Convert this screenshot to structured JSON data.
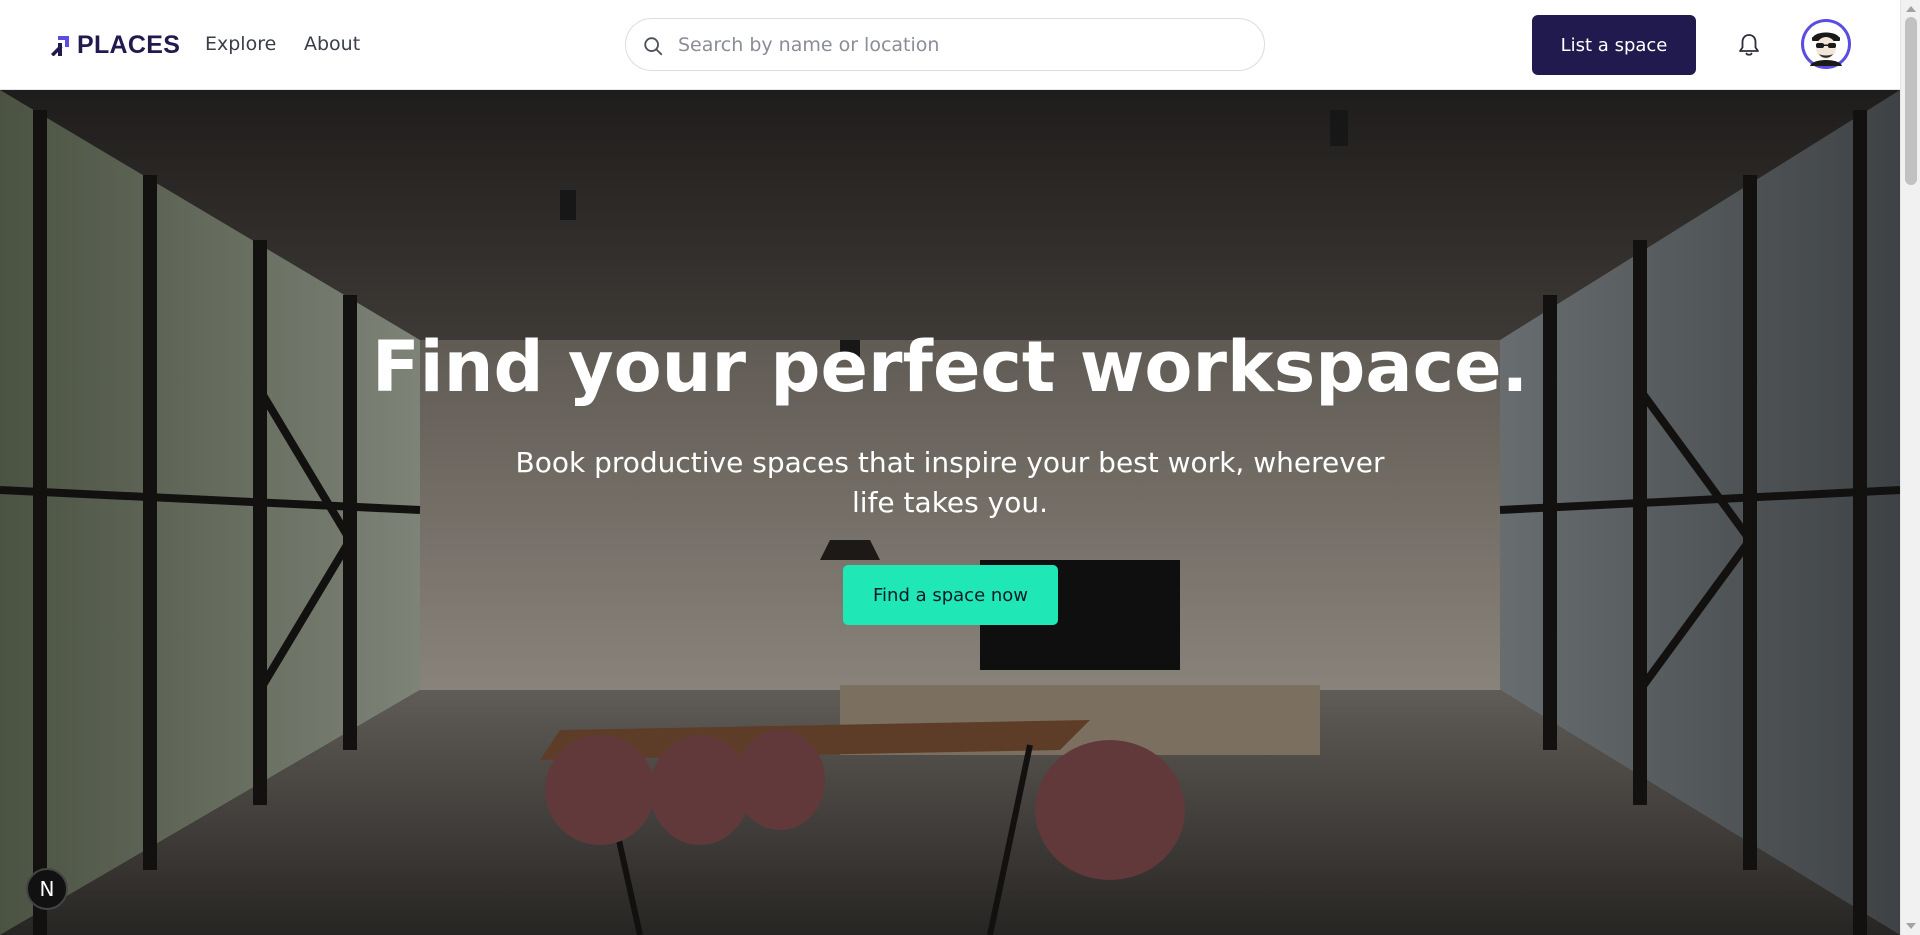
{
  "header": {
    "brand": "PLACES",
    "nav": [
      {
        "label": "Explore"
      },
      {
        "label": "About"
      }
    ],
    "search": {
      "placeholder": "Search by name or location",
      "value": "",
      "icon": "search-icon"
    },
    "list_space_label": "List a space",
    "notification_icon": "bell-icon",
    "avatar_icon": "user-avatar"
  },
  "hero": {
    "title": "Find your perfect workspace.",
    "subtitle": "Book productive spaces that inspire your best work, wherever life takes you.",
    "cta_label": "Find a space now"
  },
  "dev_badge": "N",
  "colors": {
    "brand_navy": "#211a4f",
    "cta_teal": "#1fe8b6",
    "avatar_ring": "#5b4de0"
  }
}
